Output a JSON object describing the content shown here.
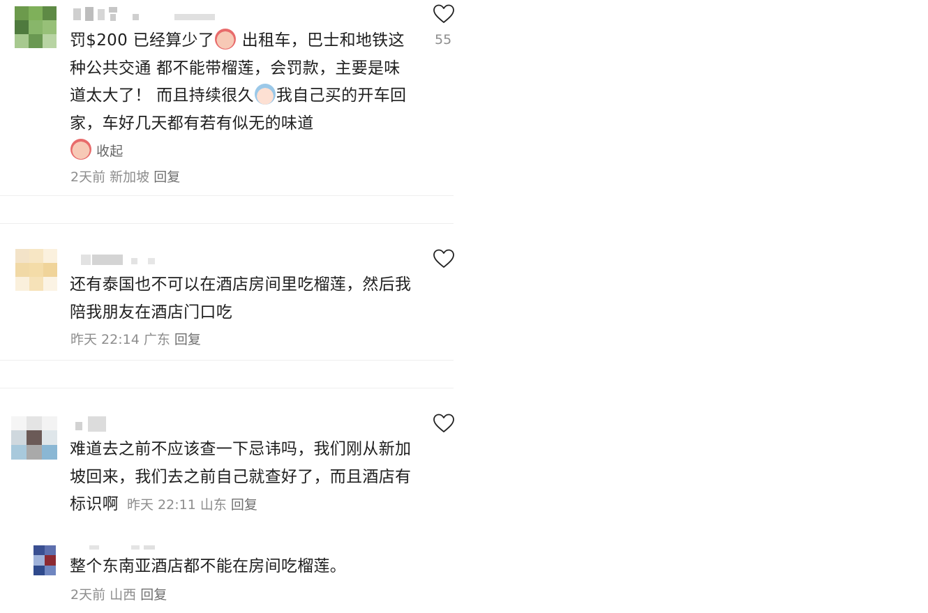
{
  "comments": [
    {
      "text_1": "罚$200 已经算少了",
      "text_2": " 出租车，巴士和地铁这种公共交通 都不能带榴莲，会罚款，主要是味道太大了！ 而且持续很久",
      "text_3": "我自己买的开车回家，车好几天都有若有似无的味道",
      "collapse_label": "收起",
      "time": "2天前",
      "location": "新加坡",
      "reply_label": "回复",
      "likes": "55",
      "emoji_1": "crying-face-emoji",
      "emoji_2": "crying-baby-emoji",
      "emoji_3": "crying-face-emoji"
    },
    {
      "text": "还有泰国也不可以在酒店房间里吃榴莲，然后我陪我朋友在酒店门口吃",
      "time": "昨天 22:14",
      "location": "广东",
      "reply_label": "回复"
    },
    {
      "text": "难道去之前不应该查一下忌讳吗，我们刚从新加坡回来，我们去之前自己就查好了，而且酒店有标识啊",
      "time": "昨天 22:11",
      "location": "山东",
      "reply_label": "回复"
    },
    {
      "text": "整个东南亚酒店都不能在房间吃榴莲。",
      "time": "2天前",
      "location": "山西",
      "reply_label": "回复"
    }
  ],
  "icons": {
    "like": "heart-outline-icon"
  },
  "colors": {
    "text": "#1f1f1f",
    "meta": "#8d8d8d",
    "separator": "#eeeeee"
  }
}
